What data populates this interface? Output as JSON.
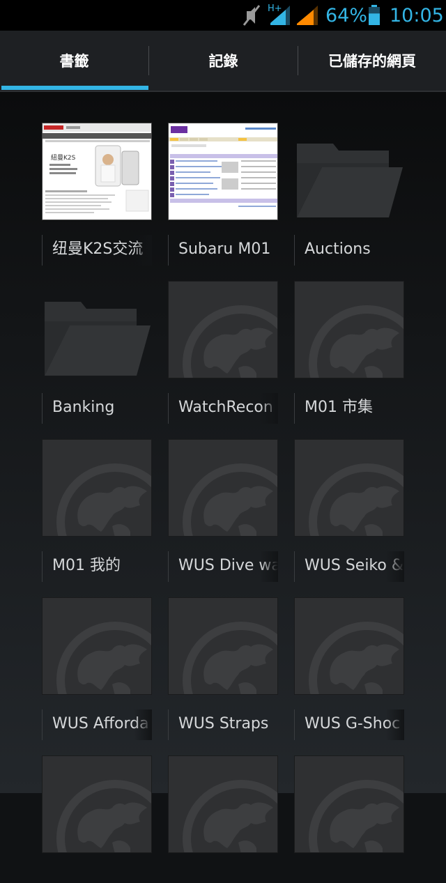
{
  "status_bar": {
    "icons": [
      "mute-icon",
      "hplus-signal-icon",
      "signal-icon",
      "battery-icon"
    ],
    "network_type": "H+",
    "battery_percent": "64%",
    "battery_level": 0.64,
    "time": "10:05",
    "accent_color": "#33b5e5",
    "signal_secondary_color": "#ff8a00"
  },
  "tabs": [
    {
      "label": "書籤",
      "selected": true
    },
    {
      "label": "記錄",
      "selected": false
    },
    {
      "label": "已儲存的網頁",
      "selected": false
    }
  ],
  "bookmarks": [
    {
      "label": "纽曼K2S交流",
      "kind": "screenshot"
    },
    {
      "label": "Subaru M01",
      "kind": "screenshot"
    },
    {
      "label": "Auctions",
      "kind": "folder"
    },
    {
      "label": "Banking",
      "kind": "folder"
    },
    {
      "label": "WatchRecon",
      "kind": "globe"
    },
    {
      "label": "M01 市集",
      "kind": "globe"
    },
    {
      "label": "M01 我的",
      "kind": "globe"
    },
    {
      "label": "WUS Dive wa",
      "kind": "globe"
    },
    {
      "label": "WUS Seiko &",
      "kind": "globe"
    },
    {
      "label": "WUS Afforda",
      "kind": "globe"
    },
    {
      "label": "WUS Straps",
      "kind": "globe"
    },
    {
      "label": "WUS G-Shoc",
      "kind": "globe"
    },
    {
      "label": "",
      "kind": "globe"
    },
    {
      "label": "",
      "kind": "globe"
    },
    {
      "label": "",
      "kind": "globe"
    }
  ],
  "thumb_text": {
    "k2s_title": "紐曼K2S"
  }
}
